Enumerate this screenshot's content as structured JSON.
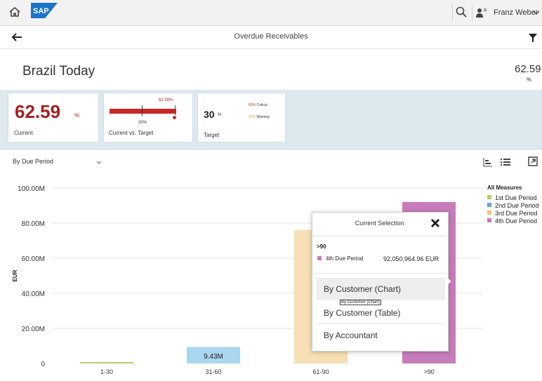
{
  "shell": {
    "logo_text": "SAP",
    "user_name": "Franz Weber",
    "icons": [
      "home-icon",
      "search-icon",
      "user-icon",
      "chevron-down-icon"
    ]
  },
  "page": {
    "title": "Overdue Receivables",
    "icons": [
      "back-arrow-icon",
      "filter-icon"
    ]
  },
  "header": {
    "app_title": "Brazil Today",
    "kpi_value": "62.59",
    "kpi_unit": "%"
  },
  "tiles": {
    "current": {
      "value": "62.59",
      "unit": "%",
      "label": "Current",
      "color": "#a51f1f"
    },
    "vs_target": {
      "label": "Current vs. Target",
      "current_pct": "62.59%",
      "target_pct": "30%",
      "current_fraction": 0.6259,
      "target_fraction": 0.3,
      "bar_color": "#c62828"
    },
    "target": {
      "value": "30",
      "unit": "%",
      "label": "Target",
      "critical_num": "60%",
      "critical_text": "Critical",
      "warning_num": "50%",
      "warning_text": "Warning"
    }
  },
  "toolbar": {
    "period_select": "By Due Period",
    "icons": [
      "bar-chart-icon",
      "list-icon",
      "expand-icon"
    ]
  },
  "legend": {
    "title": "All Measures",
    "items": [
      {
        "label": "1st Due Period",
        "color": "#b5cf6b"
      },
      {
        "label": "2nd Due Period",
        "color": "#5aa9d6"
      },
      {
        "label": "3rd Due Period",
        "color": "#f0c36d"
      },
      {
        "label": "4th Due Period",
        "color": "#c77cbb"
      }
    ]
  },
  "chart_data": {
    "type": "bar",
    "categories": [
      "1-30",
      "31-60",
      "61-90",
      ">90"
    ],
    "values": [
      0.5,
      9.43,
      76.0,
      92.05
    ],
    "colors": [
      "#b5cf6b",
      "#a9d6f0",
      "#f6dfb4",
      "#c77cbb"
    ],
    "value_label_for_31_60": "9.43M",
    "ylabel": "EUR",
    "y_ticks": [
      "0",
      "20.00M",
      "40.00M",
      "60.00M",
      "80.00M",
      "100.00M"
    ],
    "ylim": [
      0,
      100
    ],
    "grid": true,
    "legend_position": "right"
  },
  "popover": {
    "title": "Current Selection",
    "range": ">90",
    "period_label": "4th Due Period",
    "amount": "92,050,964.96 EUR",
    "items": [
      "By Customer (Chart)",
      "By Customer (Table)",
      "By Accountant"
    ],
    "tooltip": "By Customer (Chart)",
    "icons": [
      "close-icon"
    ]
  }
}
